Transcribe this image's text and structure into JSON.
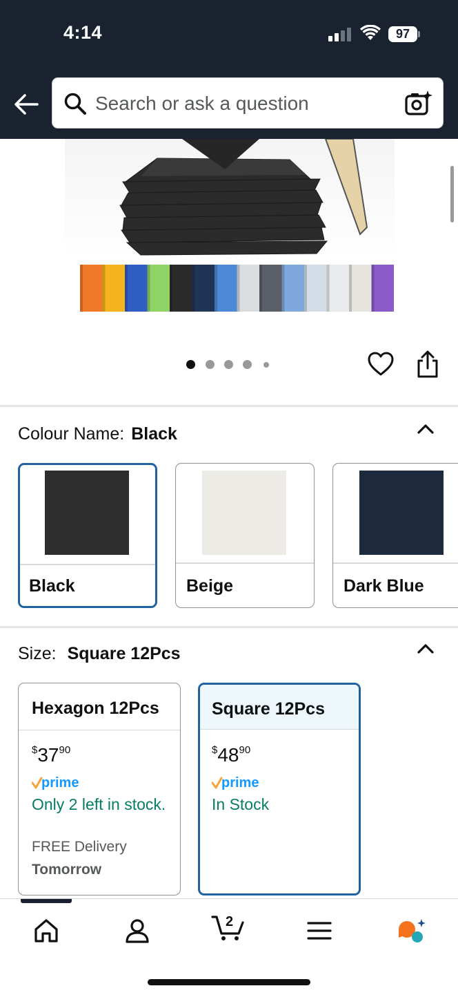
{
  "status_bar": {
    "time": "4:14",
    "battery": "97",
    "icons": [
      "signal-icon",
      "wifi-icon",
      "battery-icon"
    ]
  },
  "header": {
    "back_icon": "arrow-left-icon",
    "search": {
      "placeholder": "Search or ask a question",
      "value": "",
      "icon": "search-icon",
      "camera_icon": "camera-sparkle-icon"
    }
  },
  "gallery": {
    "image_count": 5,
    "active_index": 0,
    "actions": [
      "heart-icon",
      "share-icon"
    ],
    "swatch_strip_colors": [
      "#f07a2a",
      "#f6b51e",
      "#2f5fc4",
      "#8ed464",
      "#2a2a2a",
      "#1f3456",
      "#4d89d4",
      "#d9dde0",
      "#5b6068",
      "#7fa9dc",
      "#d2dde8",
      "#e9eaeb",
      "#e6e4df",
      "#8b5cc9"
    ]
  },
  "colour": {
    "label": "Colour Name:",
    "selected": "Black",
    "options": [
      {
        "label": "Black",
        "color": "#2d2d2d"
      },
      {
        "label": "Beige",
        "color": "#ecebe6"
      },
      {
        "label": "Dark Blue",
        "color": "#1d2a3e"
      }
    ]
  },
  "size": {
    "label": "Size:",
    "selected": "Square 12Pcs",
    "options": [
      {
        "title": "Hexagon 12Pcs",
        "price_currency": "$",
        "price_whole": "37",
        "price_fraction": "90",
        "prime": "prime",
        "stock": "Only 2 left in stock.",
        "delivery": "FREE Delivery",
        "delivery_day": "Tomorrow"
      },
      {
        "title": "Square 12Pcs",
        "price_currency": "$",
        "price_whole": "48",
        "price_fraction": "90",
        "prime": "prime",
        "stock": "In Stock"
      }
    ]
  },
  "bottom_nav": {
    "items": [
      "home-icon",
      "account-icon",
      "cart-icon",
      "menu-icon",
      "rufus-icon"
    ],
    "cart_count": "2"
  },
  "colors": {
    "header_bg": "#1a2230",
    "selected_border": "#2162a1",
    "stock_green": "#067d62",
    "prime_blue": "#1399ff",
    "prime_orange": "#f7a33a",
    "rufus_orange": "#f5731f",
    "rufus_teal": "#23a6b8"
  }
}
